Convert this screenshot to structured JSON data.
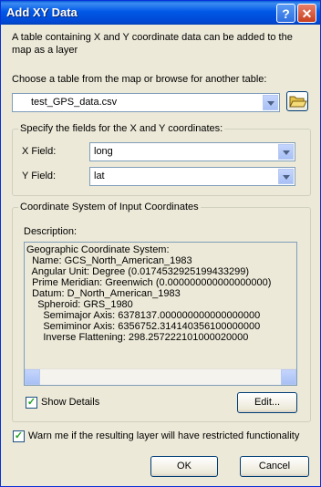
{
  "window": {
    "title": "Add XY Data",
    "help_label": "?",
    "close_label": "✕"
  },
  "intro": {
    "text_line1": "A table containing X and Y coordinate data can be added to the",
    "text_line2": "map as a layer"
  },
  "table_select": {
    "label": "Choose a table from the map or browse for another table:",
    "value": "test_GPS_data.csv",
    "browse_icon": "open-folder-icon"
  },
  "fields": {
    "group_label": "Specify the fields for the X and Y coordinates:",
    "x_label": "X Field:",
    "x_value": "long",
    "y_label": "Y Field:",
    "y_value": "lat"
  },
  "coords": {
    "group_label": "Coordinate System of Input Coordinates",
    "description_label": "Description:",
    "description_lines": [
      "Geographic Coordinate System:",
      "  Name: GCS_North_American_1983",
      "  Angular Unit: Degree (0.0174532925199433299)",
      "  Prime Meridian: Greenwich (0.000000000000000000)",
      "  Datum: D_North_American_1983",
      "    Spheroid: GRS_1980",
      "      Semimajor Axis: 6378137.000000000000000000",
      "      Semiminor Axis: 6356752.314140356100000000",
      "      Inverse Flattening: 298.257222101000020000"
    ],
    "show_details_label": "Show Details",
    "show_details_checked": true,
    "edit_label": "Edit..."
  },
  "warn": {
    "label": "Warn me if the resulting layer will have restricted functionality",
    "checked": true
  },
  "buttons": {
    "ok_label": "OK",
    "cancel_label": "Cancel"
  },
  "colors": {
    "title_bar": "#0058e6",
    "dialog_bg": "#ece9d8",
    "field_border": "#7f9db9"
  }
}
